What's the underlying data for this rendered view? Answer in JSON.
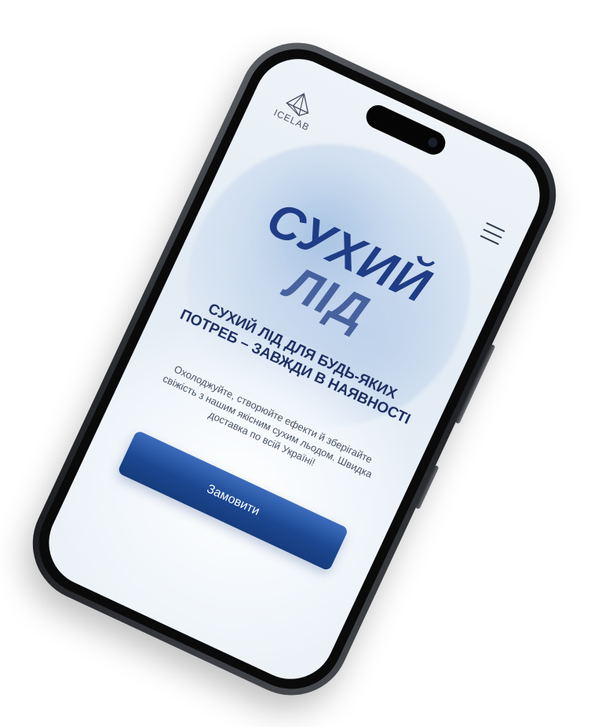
{
  "logo": {
    "text": "ICELAB"
  },
  "header": {
    "menu_icon": "hamburger-menu-icon"
  },
  "hero": {
    "title_line1": "СУХИЙ",
    "title_line2": "ЛІД",
    "subtitle": "СУХИЙ ЛІД ДЛЯ БУДЬ-ЯКИХ ПОТРЕБ – ЗАВЖДИ В НАЯВНОСТІ",
    "description": "Охолоджуйте, створюйте ефекти й зберігайте свіжість з нашим якісним сухим льодом. Швидка доставка по всій Україні!",
    "cta_label": "Замовити"
  },
  "colors": {
    "accent": "#1c4790",
    "title": "#1f3c86",
    "text_dark": "#1e2f63"
  }
}
